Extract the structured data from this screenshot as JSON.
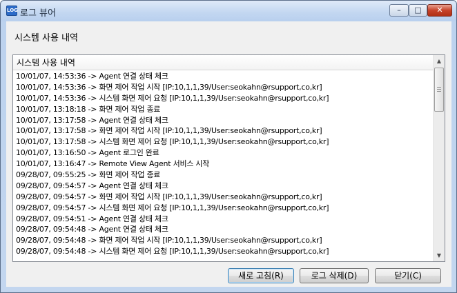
{
  "window": {
    "icon_text": "LOG",
    "title": "로그 뷰어",
    "controls": {
      "minimize": "–",
      "maximize": "□",
      "close": "✕"
    }
  },
  "section_label": "시스템 사용 내역",
  "list": {
    "header": "시스템 사용 내역",
    "rows": [
      "10/01/07, 14:53:36 -> Agent 연결 상태 체크",
      "10/01/07, 14:53:36 -> 화면 제어 작업 시작 [IP:10,1,1,39/User:seokahn@rsupport,co,kr]",
      "10/01/07, 14:53:36 -> 시스템 화면 제어 요청 [IP:10,1,1,39/User:seokahn@rsupport,co,kr]",
      "10/01/07, 13:18:18 -> 화면 제어 작업 종료",
      "10/01/07, 13:17:58 -> Agent 연결 상태 체크",
      "10/01/07, 13:17:58 -> 화면 제어 작업 시작 [IP:10,1,1,39/User:seokahn@rsupport,co,kr]",
      "10/01/07, 13:17:58 -> 시스템 화면 제어 요청 [IP:10,1,1,39/User:seokahn@rsupport,co,kr]",
      "10/01/07, 13:16:50 -> Agent 로그인 완료",
      "10/01/07, 13:16:47 -> Remote View Agent 서비스 시작",
      "09/28/07, 09:55:25 -> 화면 제어 작업 종료",
      "09/28/07, 09:54:57 -> Agent 연결 상태 체크",
      "09/28/07, 09:54:57 -> 화면 제어 작업 시작 [IP:10,1,1,39/User:seokahn@rsupport,co,kr]",
      "09/28/07, 09:54:57 -> 시스템 화면 제어 요청 [IP:10,1,1,39/User:seokahn@rsupport,co,kr]",
      "09/28/07, 09:54:51 -> Agent 연결 상태 체크",
      "09/28/07, 09:54:48 -> Agent 연결 상태 체크",
      "09/28/07, 09:54:48 -> 화면 제어 작업 시작 [IP:10,1,1,39/User:seokahn@rsupport,co,kr]",
      "09/28/07, 09:54:48 -> 시스템 화면 제어 요청 [IP:10,1,1,39/User:seokahn@rsupport,co,kr]"
    ],
    "scroll_up_glyph": "▲",
    "scroll_down_glyph": "▼"
  },
  "buttons": {
    "refresh": "새로 고침(R)",
    "delete": "로그 삭제(D)",
    "close": "닫기(C)"
  }
}
